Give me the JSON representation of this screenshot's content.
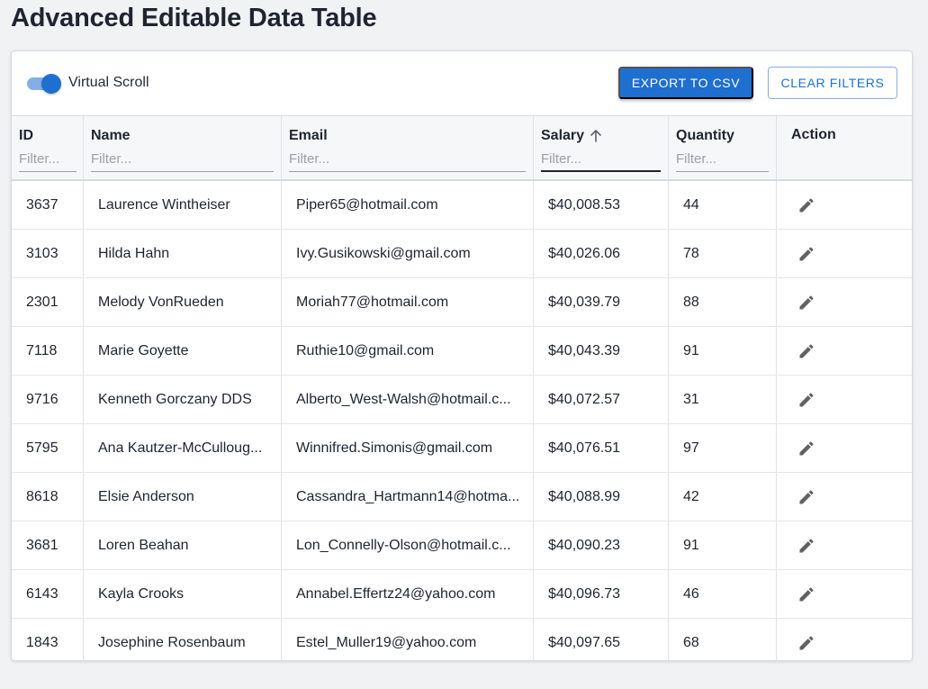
{
  "page": {
    "title": "Advanced Editable Data Table"
  },
  "toolbar": {
    "virtual_scroll_label": "Virtual Scroll",
    "virtual_scroll_enabled": true,
    "export_label": "EXPORT TO CSV",
    "clear_filters_label": "CLEAR FILTERS"
  },
  "colors": {
    "accent": "#1e6fd0",
    "accent_light": "#86aee6",
    "header_bg": "#f6f7f9",
    "page_bg": "#f1f2f4"
  },
  "table": {
    "filter_placeholder": "Filter...",
    "columns": [
      {
        "key": "id",
        "label": "ID",
        "filterable": true
      },
      {
        "key": "name",
        "label": "Name",
        "filterable": true
      },
      {
        "key": "email",
        "label": "Email",
        "filterable": true
      },
      {
        "key": "salary",
        "label": "Salary",
        "filterable": true,
        "sort": "ascending",
        "sort_icon": "arrow-up-icon"
      },
      {
        "key": "quantity",
        "label": "Quantity",
        "filterable": true
      },
      {
        "key": "action",
        "label": "Action",
        "filterable": false
      }
    ],
    "action_icon": "edit-pencil-icon",
    "rows": [
      {
        "id": "3637",
        "name": "Laurence Wintheiser",
        "email": "Piper65@hotmail.com",
        "salary": "$40,008.53",
        "quantity": "44"
      },
      {
        "id": "3103",
        "name": "Hilda Hahn",
        "email": "Ivy.Gusikowski@gmail.com",
        "salary": "$40,026.06",
        "quantity": "78"
      },
      {
        "id": "2301",
        "name": "Melody VonRueden",
        "email": "Moriah77@hotmail.com",
        "salary": "$40,039.79",
        "quantity": "88"
      },
      {
        "id": "7118",
        "name": "Marie Goyette",
        "email": "Ruthie10@gmail.com",
        "salary": "$40,043.39",
        "quantity": "91"
      },
      {
        "id": "9716",
        "name": "Kenneth Gorczany DDS",
        "email": "Alberto_West-Walsh@hotmail.c...",
        "salary": "$40,072.57",
        "quantity": "31"
      },
      {
        "id": "5795",
        "name": "Ana Kautzer-McCulloug...",
        "email": "Winnifred.Simonis@gmail.com",
        "salary": "$40,076.51",
        "quantity": "97"
      },
      {
        "id": "8618",
        "name": "Elsie Anderson",
        "email": "Cassandra_Hartmann14@hotma...",
        "salary": "$40,088.99",
        "quantity": "42"
      },
      {
        "id": "3681",
        "name": "Loren Beahan",
        "email": "Lon_Connelly-Olson@hotmail.c...",
        "salary": "$40,090.23",
        "quantity": "91"
      },
      {
        "id": "6143",
        "name": "Kayla Crooks",
        "email": "Annabel.Effertz24@yahoo.com",
        "salary": "$40,096.73",
        "quantity": "46"
      },
      {
        "id": "1843",
        "name": "Josephine Rosenbaum",
        "email": "Estel_Muller19@yahoo.com",
        "salary": "$40,097.65",
        "quantity": "68"
      }
    ]
  }
}
